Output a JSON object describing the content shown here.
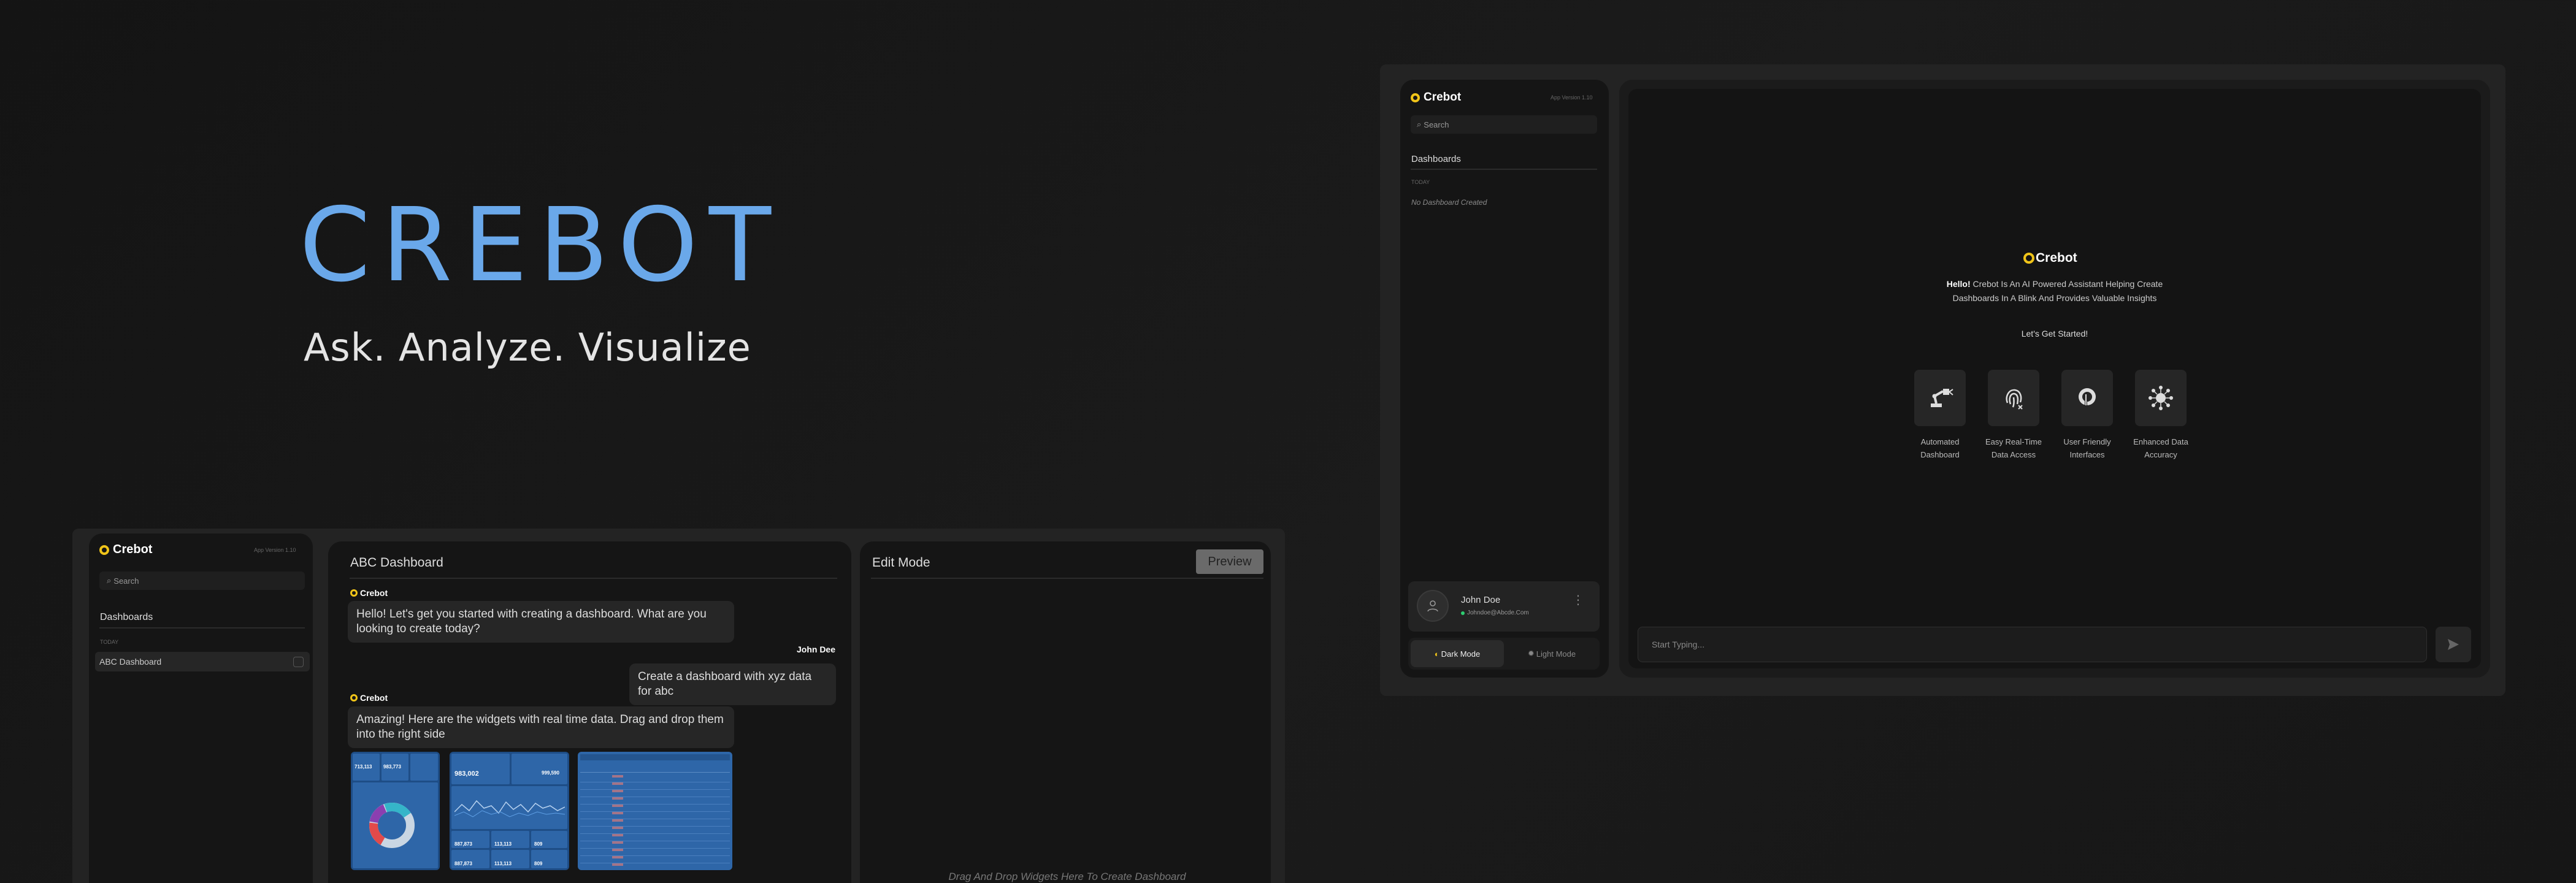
{
  "hero": {
    "title": "CREBOT",
    "tagline": "Ask. Analyze. Visualize"
  },
  "brand": {
    "name": "Crebot",
    "accent": "#f0c419",
    "title_color": "#6aa8ea"
  },
  "right_app": {
    "sidebar": {
      "app_version": "App Version 1.10",
      "search_placeholder": "Search",
      "section": "Dashboards",
      "group": "TODAY",
      "empty": "No Dashboard Created"
    },
    "user": {
      "name": "John Doe",
      "email": "Johndoe@Abcde.Com",
      "status_color": "#2ecc71"
    },
    "theme": {
      "dark": "Dark Mode",
      "light": "Light Mode"
    },
    "welcome": {
      "logo": "Crebot",
      "hello": "Hello!",
      "intro": " Crebot Is An AI Powered Assistant Helping Create Dashboards In A Blink And Provides Valuable Insights",
      "cta": "Let's Get Started!"
    },
    "features": [
      {
        "label1": "Automated",
        "label2": "Dashboard",
        "icon": "robot-arm-icon"
      },
      {
        "label1": "Easy Real-Time",
        "label2": "Data Access",
        "icon": "fingerprint-icon"
      },
      {
        "label1": "User Friendly",
        "label2": "Interfaces",
        "icon": "touch-icon"
      },
      {
        "label1": "Enhanced Data",
        "label2": "Accuracy",
        "icon": "network-icon"
      }
    ],
    "input": {
      "placeholder": "Start Typing..."
    }
  },
  "left_app": {
    "sidebar": {
      "app_version": "App Version 1.10",
      "search_placeholder": "Search",
      "section": "Dashboards",
      "group": "TODAY",
      "item": "ABC Dashboard"
    },
    "chat": {
      "title": "ABC Dashboard",
      "bot_name": "Crebot",
      "msg1": "Hello! Let's get you started with creating a dashboard. What are you looking to create today?",
      "user_name": "John Dee",
      "msg2": "Create a dashboard with xyz data for abc",
      "msg3": "Amazing! Here are the widgets with real time data. Drag and drop them into the right side"
    },
    "widgets": {
      "kpi1": "713,113",
      "kpi2": "983,773",
      "kpi3": "983,002",
      "kpi4": "999,590",
      "kpi5": "887,873",
      "kpi6": "113,113",
      "kpi7": "809",
      "kpi8": "887,873",
      "kpi9": "113,113",
      "kpi10": "809"
    },
    "edit": {
      "title": "Edit Mode",
      "preview": "Preview",
      "drop_hint": "Drag And Drop Widgets Here To Create Dashboard"
    }
  }
}
